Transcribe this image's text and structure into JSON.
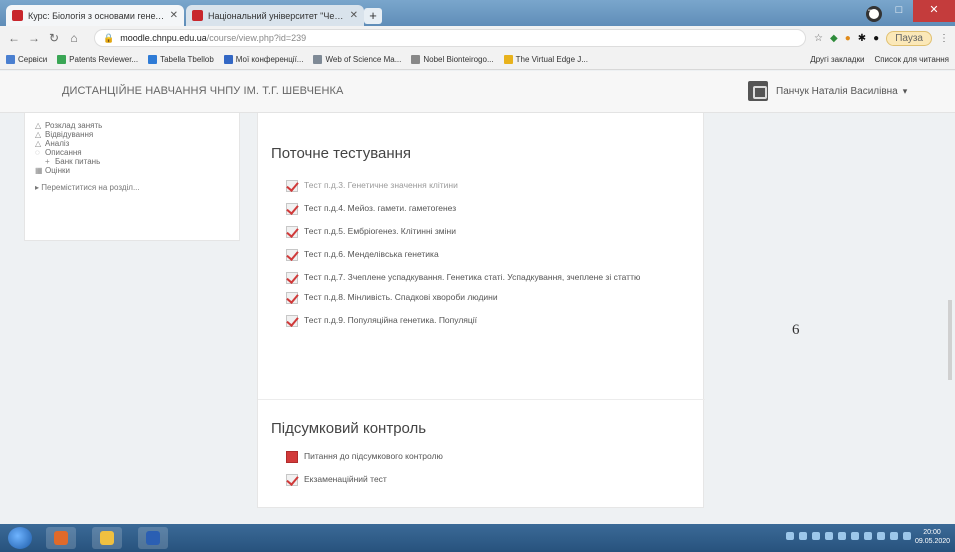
{
  "browser": {
    "tabs": [
      {
        "title": "Курс: Біологія з основами генетики"
      },
      {
        "title": "Національний університет \"Чернігівський колегіум\""
      }
    ],
    "new_tab": "+",
    "window_controls": {
      "minimize": "–",
      "maximize": "□",
      "close": "✕"
    },
    "nav": {
      "back": "←",
      "forward": "→",
      "reload": "↻",
      "home": "⌂"
    },
    "url": {
      "host": "moodle.chnpu.edu.ua",
      "path": "/course/view.php?id=239"
    },
    "pause_label": "Пауза"
  },
  "bookmarks": [
    {
      "label": "Сервіси",
      "color": "#4a7fd0"
    },
    {
      "label": "Patents Reviewer...",
      "color": "#3aa655"
    },
    {
      "label": "Tabella Tbellob",
      "color": "#2f7bd6"
    },
    {
      "label": "Мої конференції...",
      "color": "#3367c4"
    },
    {
      "label": "Web of Science Ma...",
      "color": "#7f8a96"
    },
    {
      "label": "Nobel Bionteirogo...",
      "color": "#888888"
    },
    {
      "label": "The Virtual Edge J...",
      "color": "#e8b21c"
    }
  ],
  "bookmarks_right": [
    "Другі закладки",
    "Список для читання"
  ],
  "moodle": {
    "site_name": "ДИСТАНЦІЙНЕ НАВЧАННЯ ЧНПУ ІМ. Т.Г. ШЕВЧЕНКА",
    "user_name": "Панчук Наталія Василівна"
  },
  "sidebar": {
    "items": [
      {
        "icon": "△",
        "label": "Розклад занять"
      },
      {
        "icon": "△",
        "label": "Відвідування"
      },
      {
        "icon": "△",
        "label": "Аналіз"
      },
      {
        "icon": "◌",
        "label": "Описання"
      },
      {
        "icon": "+",
        "label": "Банк питань",
        "sub": true
      },
      {
        "icon": "▦",
        "label": "Оцінки"
      }
    ],
    "more_link": "▸ Переміститися на розділ..."
  },
  "sections": [
    {
      "title": "Поточне тестування",
      "activities": [
        {
          "label": "Тест п.д.3. Генетичне значення клітини",
          "faded": true
        },
        {
          "label": "Тест п.д.4. Мейоз. гамети. гаметогенез"
        },
        {
          "label": "Тест п.д.5. Ембріогенез. Клітинні зміни"
        },
        {
          "label": "Тест п.д.6. Менделівська генетика"
        },
        {
          "label": "Тест п.д.7. Зчеплене успадкування. Генетика статі. Успадкування, зчеплене зі статтю",
          "tall": true
        },
        {
          "label": "Тест п.д.8. Мінливість. Спадкові хвороби людини"
        },
        {
          "label": "Тест п.д.9. Популяційна генетика. Популяції"
        }
      ]
    },
    {
      "title": "Підсумковий контроль",
      "activities": [
        {
          "label": "Питання до підсумкового контролю",
          "book": true
        },
        {
          "label": "Екзаменаційний тест"
        }
      ]
    }
  ],
  "page_number": "6",
  "taskbar": {
    "apps": [
      {
        "color": "#e06a2a"
      },
      {
        "color": "#f0c040"
      },
      {
        "color": "#2b5fb3"
      }
    ],
    "clock_time": "20:00",
    "clock_date": "09.05.2020"
  }
}
